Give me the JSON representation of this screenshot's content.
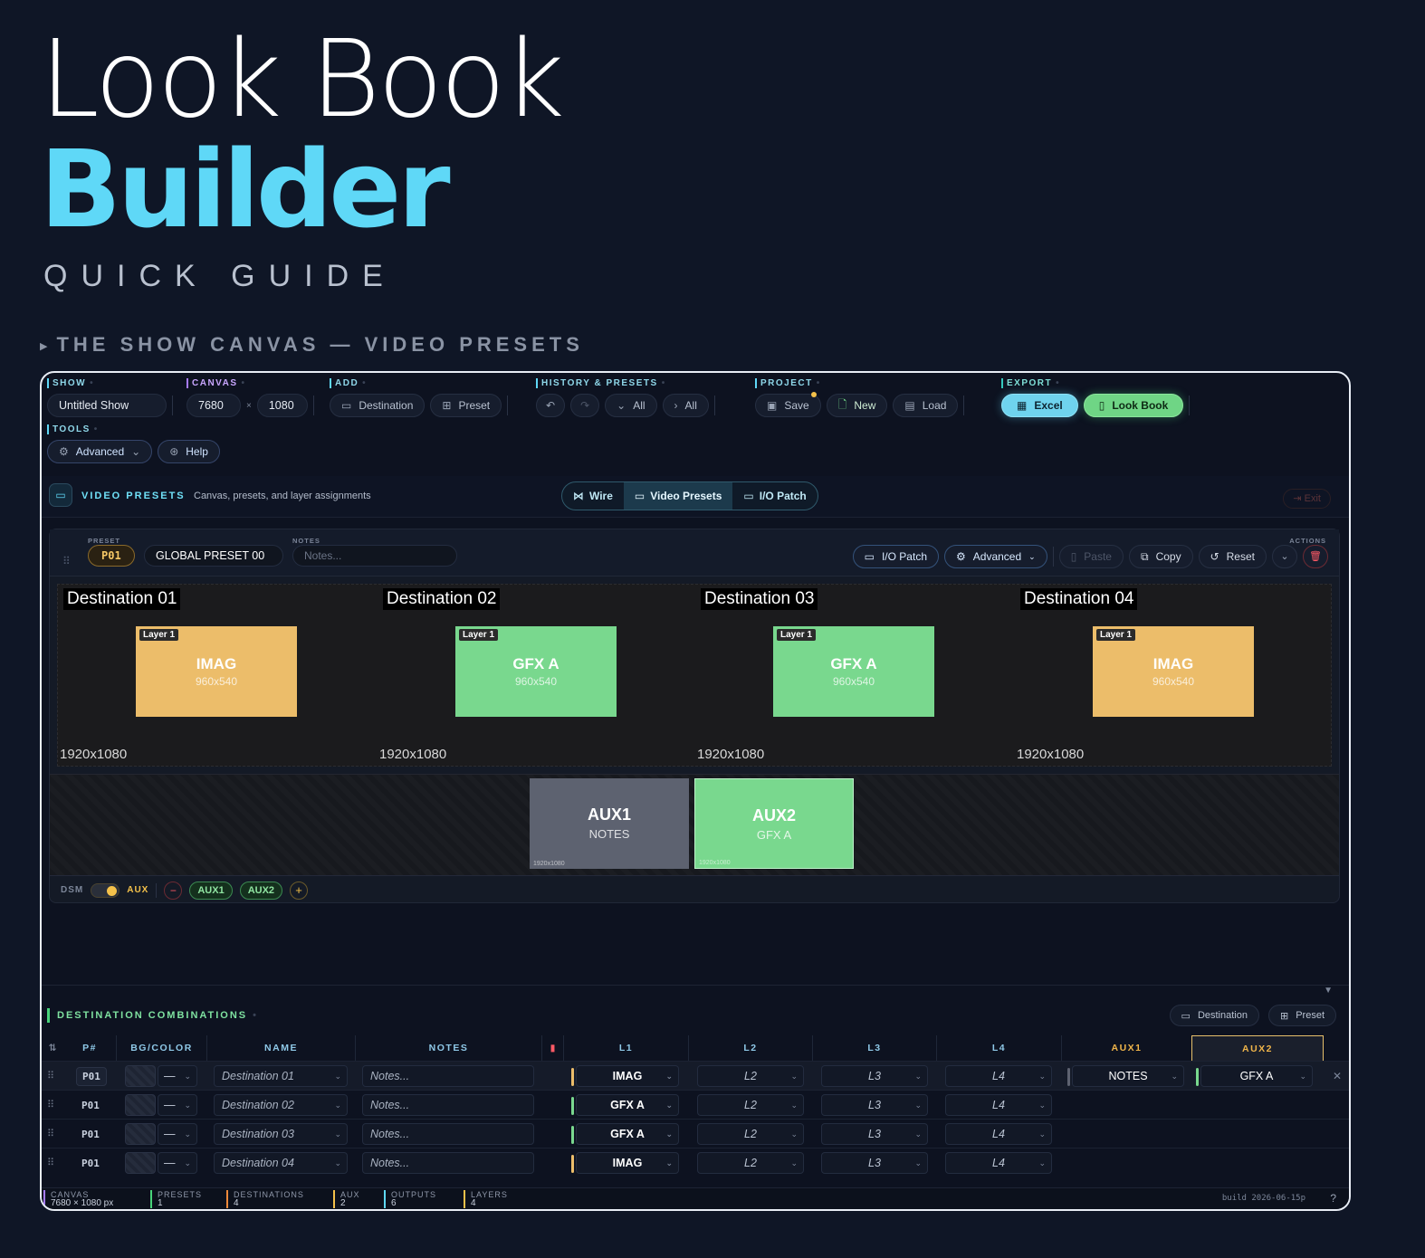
{
  "hero": {
    "line1": "Look Book",
    "line2": "Builder",
    "line3": "QUICK GUIDE"
  },
  "section": {
    "title": "THE SHOW CANVAS — VIDEO PRESETS"
  },
  "colors": {
    "accent": "#5fd8f7",
    "imag": "#ecbd6a",
    "gfx": "#79d88e",
    "aux_grey": "#5d6270",
    "delete": "#ff5a66"
  },
  "toolbar": {
    "show": {
      "label": "SHOW",
      "value": "Untitled Show"
    },
    "canvas": {
      "label": "CANVAS",
      "width": "7680",
      "x": "×",
      "height": "1080"
    },
    "add": {
      "label": "ADD",
      "destination": "Destination",
      "preset": "Preset"
    },
    "history": {
      "label": "HISTORY & PRESETS",
      "undo_icon": "↶",
      "redo_icon": "↷",
      "collapse_all": "All",
      "expand_all": "All"
    },
    "project": {
      "label": "PROJECT",
      "save": "Save",
      "new": "New",
      "load": "Load"
    },
    "export": {
      "label": "EXPORT",
      "excel": "Excel",
      "lookbook": "Look Book"
    },
    "tools": {
      "label": "TOOLS",
      "advanced": "Advanced",
      "help": "Help"
    }
  },
  "view": {
    "title": "VIDEO PRESETS",
    "subtitle": "Canvas, presets, and layer assignments",
    "tabs": [
      "Wire",
      "Video Presets",
      "I/O Patch"
    ],
    "active_tab": "Video Presets",
    "exit": "Exit"
  },
  "preset": {
    "preset_label": "PRESET",
    "notes_label": "NOTES",
    "actions_label": "ACTIONS",
    "id": "P01",
    "name": "GLOBAL PRESET 00",
    "notes_placeholder": "Notes...",
    "io_patch": "I/O Patch",
    "advanced": "Advanced",
    "paste": "Paste",
    "copy": "Copy",
    "reset": "Reset"
  },
  "destinations": [
    {
      "title": "Destination 01",
      "res": "1920x1080",
      "layer_tag": "Layer 1",
      "source": "IMAG",
      "source_res": "960x540",
      "kind": "imag"
    },
    {
      "title": "Destination 02",
      "res": "1920x1080",
      "layer_tag": "Layer 1",
      "source": "GFX A",
      "source_res": "960x540",
      "kind": "gfx"
    },
    {
      "title": "Destination 03",
      "res": "1920x1080",
      "layer_tag": "Layer 1",
      "source": "GFX A",
      "source_res": "960x540",
      "kind": "gfx"
    },
    {
      "title": "Destination 04",
      "res": "1920x1080",
      "layer_tag": "Layer 1",
      "source": "IMAG",
      "source_res": "960x540",
      "kind": "imag"
    }
  ],
  "aux": [
    {
      "name": "AUX1",
      "source": "NOTES",
      "res": "1920x1080"
    },
    {
      "name": "AUX2",
      "source": "GFX A",
      "res": "1920x1080"
    }
  ],
  "dsm": {
    "label": "DSM",
    "mode": "AUX",
    "pills": [
      "AUX1",
      "AUX2"
    ]
  },
  "combos": {
    "title": "DESTINATION COMBINATIONS",
    "add_destination": "Destination",
    "add_preset": "Preset",
    "headers": {
      "p": "P#",
      "bg": "BG/COLOR",
      "name": "NAME",
      "notes": "NOTES",
      "l1": "L1",
      "l2": "L2",
      "l3": "L3",
      "l4": "L4",
      "aux1": "AUX1",
      "aux2": "AUX2"
    },
    "rows": [
      {
        "p": "P01",
        "bg": "—",
        "name": "Destination 01",
        "notes": "Notes...",
        "l1": "IMAG",
        "l2": "L2",
        "l3": "L3",
        "l4": "L4",
        "aux1": "NOTES",
        "aux2": "GFX A"
      },
      {
        "p": "P01",
        "bg": "—",
        "name": "Destination 02",
        "notes": "Notes...",
        "l1": "GFX A",
        "l2": "L2",
        "l3": "L3",
        "l4": "L4"
      },
      {
        "p": "P01",
        "bg": "—",
        "name": "Destination 03",
        "notes": "Notes...",
        "l1": "GFX A",
        "l2": "L2",
        "l3": "L3",
        "l4": "L4"
      },
      {
        "p": "P01",
        "bg": "—",
        "name": "Destination 04",
        "notes": "Notes...",
        "l1": "IMAG",
        "l2": "L2",
        "l3": "L3",
        "l4": "L4"
      }
    ]
  },
  "status": {
    "canvas": {
      "label": "CANVAS",
      "value": "7680 × 1080 px"
    },
    "presets": {
      "label": "PRESETS",
      "value": "1"
    },
    "destinations": {
      "label": "DESTINATIONS",
      "value": "4"
    },
    "aux": {
      "label": "AUX",
      "value": "2"
    },
    "outputs": {
      "label": "OUTPUTS",
      "value": "6"
    },
    "layers": {
      "label": "LAYERS",
      "value": "4"
    },
    "build": "build 2026-06-15p",
    "help": "?"
  }
}
